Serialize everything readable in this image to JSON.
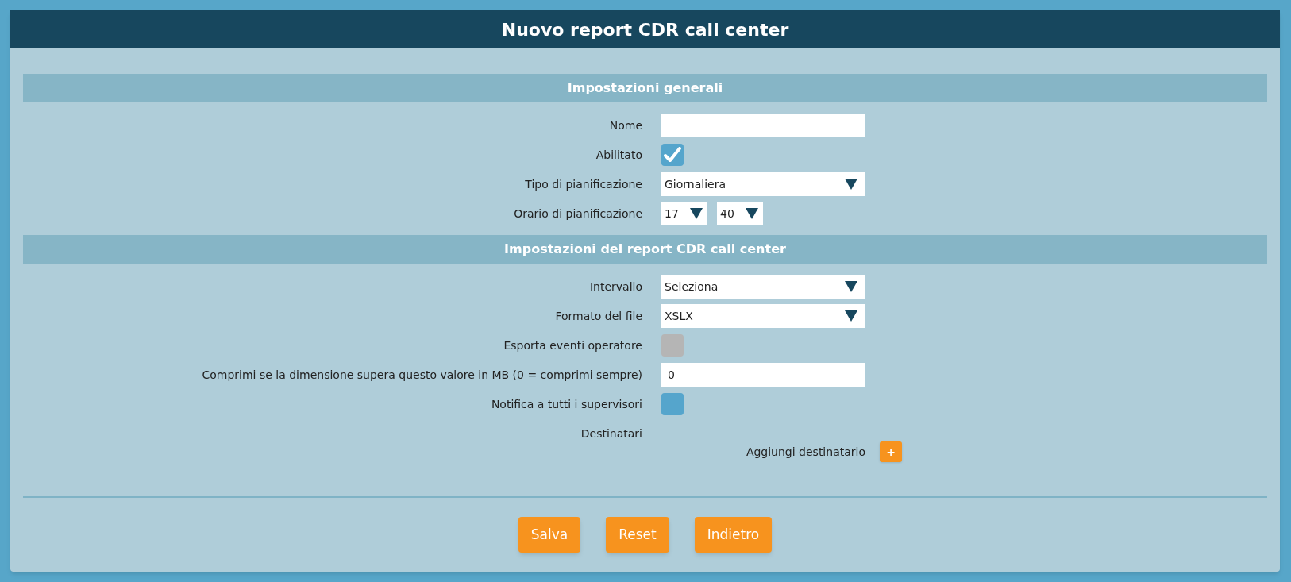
{
  "window": {
    "title": "Nuovo report CDR call center"
  },
  "sections": [
    {
      "title": "Impostazioni generali",
      "fields": [
        {
          "kind": "text",
          "label": "Nome"
        },
        {
          "kind": "checkbox",
          "label": "Abilitato",
          "checked": true,
          "disabled": false
        },
        {
          "kind": "select",
          "label": "Tipo di pianificazione",
          "value": "Giornaliera"
        },
        {
          "kind": "time",
          "label": "Orario di pianificazione",
          "hour": "17",
          "minute": "40"
        }
      ]
    },
    {
      "title": "Impostazioni del report CDR call center",
      "fields": [
        {
          "kind": "select",
          "label": "Intervallo",
          "value": "Seleziona"
        },
        {
          "kind": "select",
          "label": "Formato del file",
          "value": "XSLX"
        },
        {
          "kind": "checkbox",
          "label": "Esporta eventi operatore",
          "checked": false,
          "disabled": true
        },
        {
          "kind": "text",
          "label": "Comprimi se la dimensione supera questo valore in MB (0 = comprimi sempre)",
          "value": "0"
        },
        {
          "kind": "checkbox",
          "label": "Notifica a tutti i supervisori",
          "checked": false,
          "disabled": false
        },
        {
          "kind": "recipients",
          "label": "Destinatari",
          "add_label": "Aggiungi destinatario",
          "add_button": "+"
        }
      ]
    }
  ],
  "buttons": [
    "Salva",
    "Reset",
    "Indietro"
  ]
}
